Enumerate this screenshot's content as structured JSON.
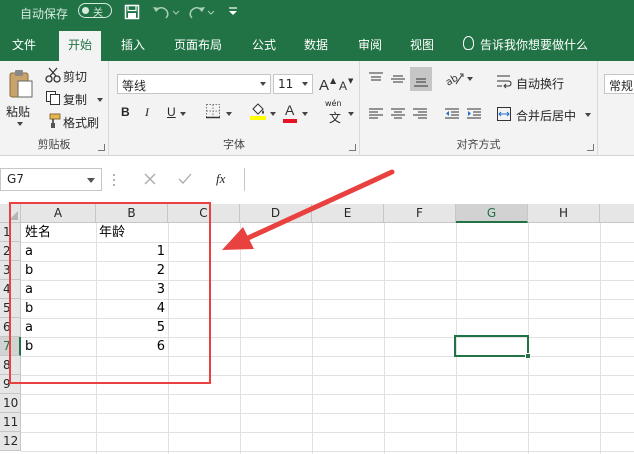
{
  "titlebar": {
    "autosave_label": "自动保存",
    "autosave_state": "关"
  },
  "menu": {
    "tabs": [
      "文件",
      "开始",
      "插入",
      "页面布局",
      "公式",
      "数据",
      "审阅",
      "视图"
    ],
    "active_index": 1,
    "help_text": "告诉我你想要做什么"
  },
  "ribbon": {
    "clipboard": {
      "paste": "粘贴",
      "cut": "剪切",
      "copy": "复制",
      "format_painter": "格式刷",
      "label": "剪贴板"
    },
    "font": {
      "font_name": "等线",
      "font_size": "11",
      "bold": "B",
      "italic": "I",
      "underline": "U",
      "font_color_letter": "A",
      "wen_top": "wén",
      "wen_bottom": "文",
      "label": "字体"
    },
    "alignment": {
      "wrap_text": "自动换行",
      "merge_center": "合并后居中",
      "label": "对齐方式"
    },
    "number": {
      "format": "常规"
    }
  },
  "formula_bar": {
    "name_box": "G7",
    "fx": "fx",
    "value": ""
  },
  "sheet": {
    "columns": [
      "A",
      "B",
      "C",
      "D",
      "E",
      "F",
      "G",
      "H"
    ],
    "rows": [
      "1",
      "2",
      "3",
      "4",
      "5",
      "6",
      "7",
      "8",
      "9",
      "10",
      "11",
      "12"
    ],
    "selected_column": "G",
    "selected_row": "7",
    "header_row": {
      "a": "姓名",
      "b": "年龄"
    },
    "data": [
      {
        "a": "a",
        "b": "1"
      },
      {
        "a": "b",
        "b": "2"
      },
      {
        "a": "a",
        "b": "3"
      },
      {
        "a": "b",
        "b": "4"
      },
      {
        "a": "a",
        "b": "5"
      },
      {
        "a": "b",
        "b": "6"
      }
    ]
  },
  "colors": {
    "excel_green": "#217346",
    "annotation_red": "#e8413f"
  }
}
